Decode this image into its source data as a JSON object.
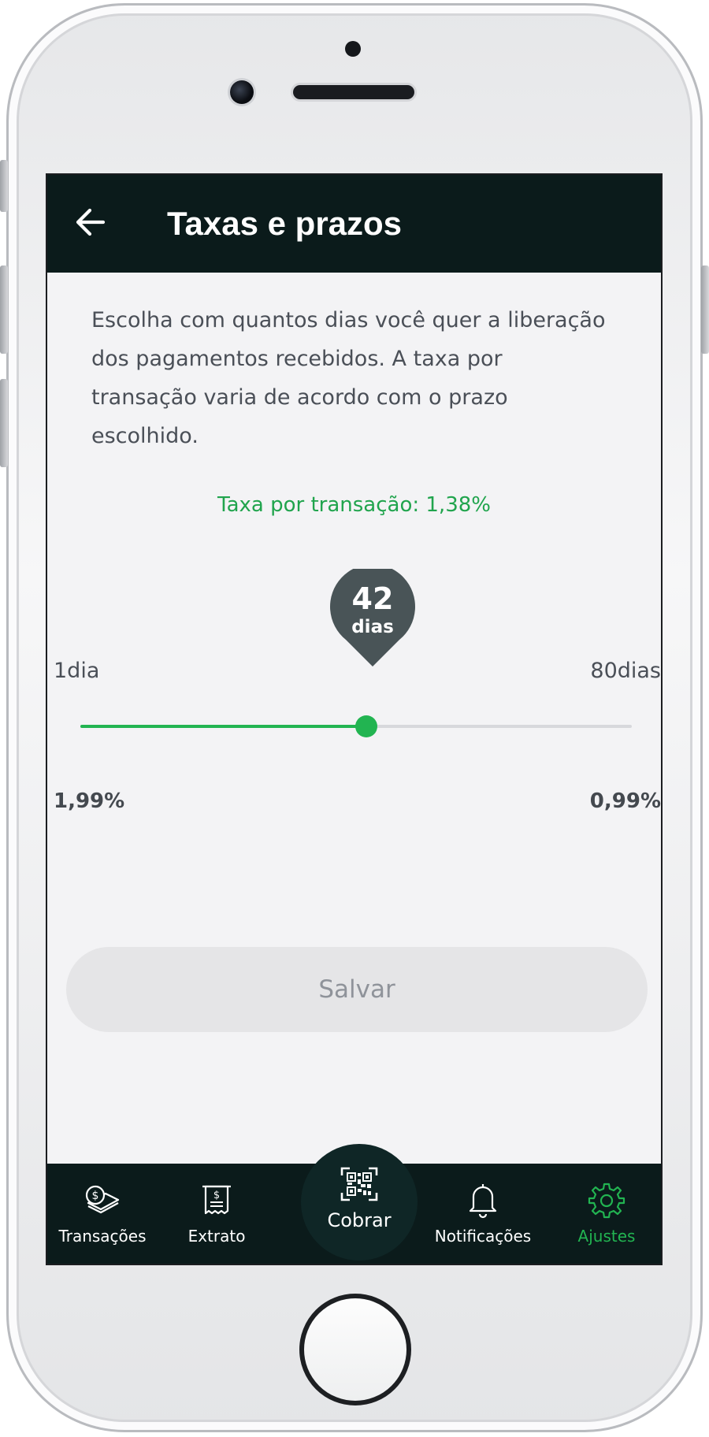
{
  "header": {
    "title": "Taxas e prazos",
    "back_icon": "arrow-left-icon"
  },
  "content": {
    "description": "Escolha com quantos dias você quer a liberação dos pagamentos recebidos. A taxa por transação varia de acordo com o prazo escolhido.",
    "fee_label": "Taxa por transação: 1,38%",
    "fee_rate": 1.38
  },
  "slider": {
    "value": "42",
    "unit": "dias",
    "min_label": "1dia",
    "max_label": "80dias",
    "min_value": 1,
    "max_value": 80,
    "current_value": 42,
    "rate_min_label": "1,99%",
    "rate_max_label": "0,99%"
  },
  "actions": {
    "save_label": "Salvar"
  },
  "nav": {
    "items": [
      {
        "label": "Transações",
        "icon": "money-coins-icon"
      },
      {
        "label": "Extrato",
        "icon": "receipt-icon"
      },
      {
        "label": "Cobrar",
        "icon": "qr-code-icon"
      },
      {
        "label": "Notificações",
        "icon": "bell-icon"
      },
      {
        "label": "Ajustes",
        "icon": "gear-icon"
      }
    ],
    "active_index": 4
  },
  "colors": {
    "header_bg": "#0b1b1b",
    "accent_green": "#22b451",
    "screen_bg": "#f3f3f5"
  }
}
